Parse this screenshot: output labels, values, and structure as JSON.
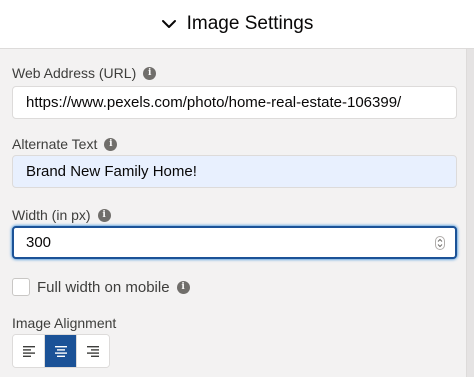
{
  "header": {
    "title": "Image Settings",
    "icon": "chevron-down-icon"
  },
  "fields": {
    "url": {
      "label": "Web Address (URL)",
      "value": "https://www.pexels.com/photo/home-real-estate-106399/"
    },
    "alt": {
      "label": "Alternate Text",
      "value": "Brand New Family Home!"
    },
    "width": {
      "label": "Width (in px)",
      "value": "300"
    }
  },
  "mobile": {
    "label": "Full width on mobile",
    "checked": false
  },
  "alignment": {
    "label": "Image Alignment",
    "options": [
      "left",
      "center",
      "right"
    ],
    "selected": "center"
  },
  "colors": {
    "accent": "#1b5297",
    "autofill_bg": "#e8f0fe",
    "info_icon": "#706e6b"
  }
}
